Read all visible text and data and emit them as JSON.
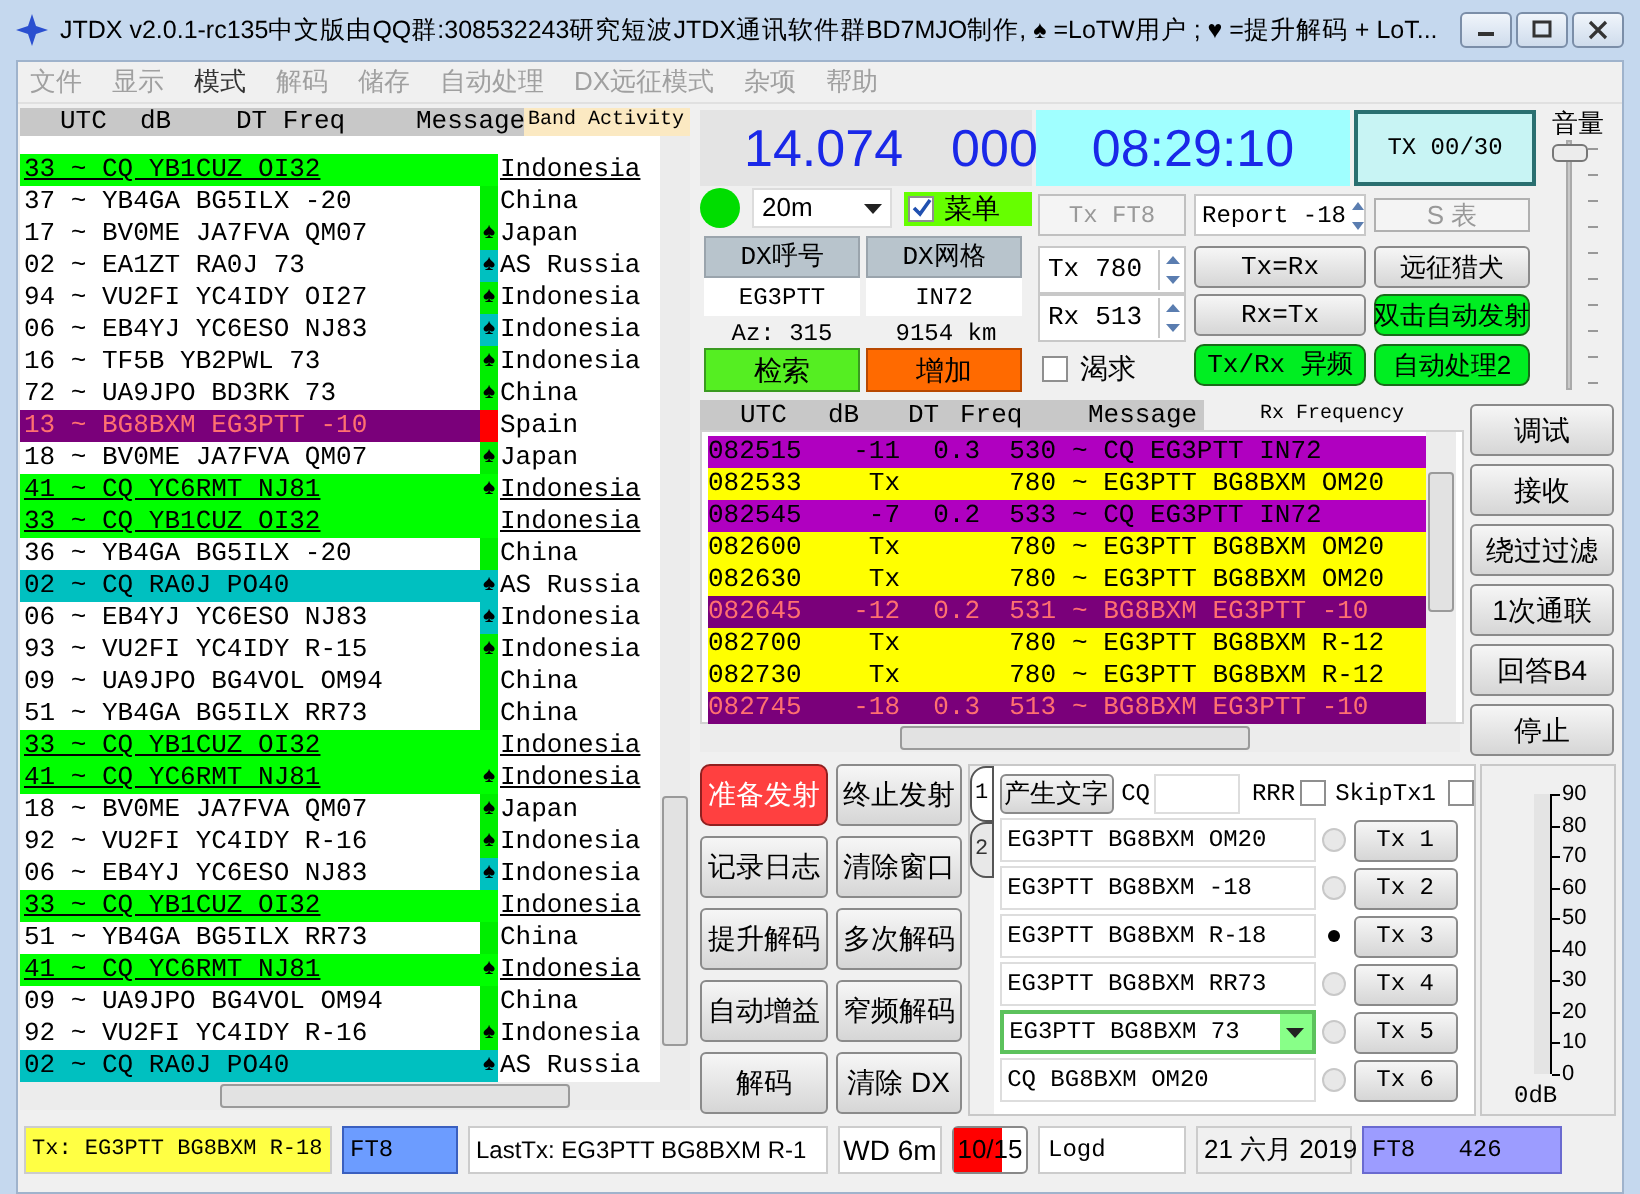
{
  "window": {
    "title": "JTDX  v2.0.1-rc135中文版由QQ群:308532243研究短波JTDX通讯软件群BD7MJO制作, ♠ =LoTW用户 ; ♥ =提升解码 + LoT..."
  },
  "menu": [
    {
      "label": "文件",
      "disabled": true
    },
    {
      "label": "显示",
      "disabled": true
    },
    {
      "label": "模式",
      "disabled": false
    },
    {
      "label": "解码",
      "disabled": true
    },
    {
      "label": "储存",
      "disabled": true
    },
    {
      "label": "自动处理",
      "disabled": true
    },
    {
      "label": "DX远征模式",
      "disabled": true
    },
    {
      "label": "杂项",
      "disabled": true
    },
    {
      "label": "帮助",
      "disabled": true
    }
  ],
  "band_activity": {
    "title": "Band Activity",
    "columns": [
      "UTC",
      "dB",
      "DT Freq",
      "Message"
    ],
    "rows": [
      {
        "text": "33 ~ CQ YB1CUZ OI32",
        "country": "Indonesia",
        "kind": "cq",
        "color": "#00ff00"
      },
      {
        "text": "37 ~ YB4GA BG5ILX -20",
        "country": "China",
        "kind": "plain",
        "color": "#00ee00"
      },
      {
        "text": "17 ~ BV0ME JA7FVA QM07",
        "mark": "♠",
        "country": "Japan",
        "kind": "plain",
        "color": "#00ee00"
      },
      {
        "text": "02 ~ EA1ZT RA0J 73",
        "mark": "♠",
        "country": "AS Russia",
        "kind": "plain",
        "color": "#00c0c0"
      },
      {
        "text": "94 ~ VU2FI YC4IDY OI27",
        "mark": "♠",
        "country": "Indonesia",
        "kind": "plain",
        "color": "#00ee00"
      },
      {
        "text": "06 ~ EB4YJ YC6ESO NJ83",
        "mark": "♠",
        "country": "Indonesia",
        "kind": "plain",
        "color": "#00c0c0"
      },
      {
        "text": "16 ~ TF5B YB2PWL 73",
        "mark": "♠",
        "country": "Indonesia",
        "kind": "plain",
        "color": "#00ee00"
      },
      {
        "text": "72 ~ UA9JPO BD3RK 73",
        "mark": "♠",
        "country": "China",
        "kind": "plain",
        "color": "#00ee00"
      },
      {
        "text": "13 ~ BG8BXM EG3PTT -10",
        "country": "Spain",
        "kind": "me",
        "color": "#ff0000"
      },
      {
        "text": "18 ~ BV0ME JA7FVA QM07",
        "mark": "♠",
        "country": "Japan",
        "kind": "plain",
        "color": "#00ee00"
      },
      {
        "text": "41 ~ CQ YC6RMT NJ81",
        "mark": "♠",
        "country": "Indonesia",
        "kind": "cq",
        "color": "#00ff00"
      },
      {
        "text": "33 ~ CQ YB1CUZ OI32",
        "country": "Indonesia",
        "kind": "cq",
        "color": "#00ff00"
      },
      {
        "text": "36 ~ YB4GA BG5ILX -20",
        "country": "China",
        "kind": "plain",
        "color": "#00ee00"
      },
      {
        "text": "02 ~ CQ RA0J PO40",
        "mark": "♠",
        "country": "AS Russia",
        "kind": "dx",
        "color": "#00c0c0"
      },
      {
        "text": "06 ~ EB4YJ YC6ESO NJ83",
        "mark": "♠",
        "country": "Indonesia",
        "kind": "plain",
        "color": "#00c0c0"
      },
      {
        "text": "93 ~ VU2FI YC4IDY R-15",
        "mark": "♠",
        "country": "Indonesia",
        "kind": "plain",
        "color": "#00ee00"
      },
      {
        "text": "09 ~ UA9JPO BG4VOL OM94",
        "country": "China",
        "kind": "plain",
        "color": "#00ee00"
      },
      {
        "text": "51 ~ YB4GA BG5ILX RR73",
        "country": "China",
        "kind": "plain",
        "color": "#00ee00"
      },
      {
        "text": "33 ~ CQ YB1CUZ OI32",
        "country": "Indonesia",
        "kind": "cq",
        "color": "#00ff00"
      },
      {
        "text": "41 ~ CQ YC6RMT NJ81",
        "mark": "♠",
        "country": "Indonesia",
        "kind": "cq",
        "color": "#00ff00"
      },
      {
        "text": "18 ~ BV0ME JA7FVA QM07",
        "mark": "♠",
        "country": "Japan",
        "kind": "plain",
        "color": "#00ee00"
      },
      {
        "text": "92 ~ VU2FI YC4IDY R-16",
        "mark": "♠",
        "country": "Indonesia",
        "kind": "plain",
        "color": "#00ee00"
      },
      {
        "text": "06 ~ EB4YJ YC6ESO NJ83",
        "mark": "♠",
        "country": "Indonesia",
        "kind": "plain",
        "color": "#00c0c0"
      },
      {
        "text": "33 ~ CQ YB1CUZ OI32",
        "country": "Indonesia",
        "kind": "cq",
        "color": "#00ff00"
      },
      {
        "text": "51 ~ YB4GA BG5ILX RR73",
        "country": "China",
        "kind": "plain",
        "color": "#00ee00"
      },
      {
        "text": "41 ~ CQ YC6RMT NJ81",
        "mark": "♠",
        "country": "Indonesia",
        "kind": "cq",
        "color": "#00ff00"
      },
      {
        "text": "09 ~ UA9JPO BG4VOL OM94",
        "country": "China",
        "kind": "plain",
        "color": "#00ee00"
      },
      {
        "text": "92 ~ VU2FI YC4IDY R-16",
        "mark": "♠",
        "country": "Indonesia",
        "kind": "plain",
        "color": "#00ee00"
      },
      {
        "text": "02 ~ CQ RA0J PO40",
        "mark": "♠",
        "country": "AS Russia",
        "kind": "dx",
        "color": "#00c0c0"
      }
    ]
  },
  "frequency": {
    "mhz": "14.074",
    "hz": "000"
  },
  "clock": "08:29:10",
  "tx_counter": "TX 00/30",
  "volume": {
    "label": "音量",
    "level": 0.98
  },
  "band": {
    "value": "20m",
    "online": true
  },
  "menu_toggle": {
    "label": "菜单",
    "checked": true
  },
  "dx": {
    "call_label": "DX呼号",
    "grid_label": "DX网格",
    "call": "EG3PTT",
    "grid": "IN72",
    "azimuth": "Az: 315",
    "distance": "9154 km",
    "lookup": "检索",
    "add": "增加"
  },
  "controls": {
    "tx_mode": {
      "label": "Tx FT8",
      "disabled": true
    },
    "report": "Report -18",
    "s_meter": {
      "label": "S 表",
      "disabled": true
    },
    "tx_freq": {
      "label": "Tx",
      "value": "780"
    },
    "rx_freq": {
      "label": "Rx",
      "value": "513"
    },
    "want": {
      "label": "渴求",
      "checked": false
    },
    "buttons": [
      {
        "label": "Tx=Rx",
        "on": false
      },
      {
        "label": "远征猎犬",
        "on": false
      },
      {
        "label": "Rx=Tx",
        "on": false
      },
      {
        "label": "双击自动发射",
        "on": true
      },
      {
        "label": "Tx/Rx 异频",
        "on": true
      },
      {
        "label": "自动处理2",
        "on": true
      }
    ]
  },
  "rx_frequency": {
    "title": "Rx Frequency",
    "columns": [
      "UTC",
      "dB",
      "DT",
      "Freq",
      "Message"
    ],
    "rows": [
      {
        "utc": "082515",
        "db": "-11",
        "dt": "0.3",
        "freq": "530",
        "message": "~ CQ EG3PTT IN72",
        "kind": "rx"
      },
      {
        "utc": "082533",
        "db": "Tx",
        "freq": "780",
        "message": "~ EG3PTT BG8BXM OM20",
        "kind": "tx"
      },
      {
        "utc": "082545",
        "db": "-7",
        "dt": "0.2",
        "freq": "533",
        "message": "~ CQ EG3PTT IN72",
        "kind": "rx"
      },
      {
        "utc": "082600",
        "db": "Tx",
        "freq": "780",
        "message": "~ EG3PTT BG8BXM OM20",
        "kind": "tx"
      },
      {
        "utc": "082630",
        "db": "Tx",
        "freq": "780",
        "message": "~ EG3PTT BG8BXM OM20",
        "kind": "tx"
      },
      {
        "utc": "082645",
        "db": "-12",
        "dt": "0.2",
        "freq": "531",
        "message": "~ BG8BXM EG3PTT -10",
        "kind": "me"
      },
      {
        "utc": "082700",
        "db": "Tx",
        "freq": "780",
        "message": "~ EG3PTT BG8BXM R-12",
        "kind": "tx"
      },
      {
        "utc": "082730",
        "db": "Tx",
        "freq": "780",
        "message": "~ EG3PTT BG8BXM R-12",
        "kind": "tx"
      },
      {
        "utc": "082745",
        "db": "-18",
        "dt": "0.3",
        "freq": "513",
        "message": "~ BG8BXM EG3PTT -10",
        "kind": "me"
      }
    ]
  },
  "side_buttons": [
    "调试",
    "接收",
    "绕过过滤",
    "1次通联",
    "回答B4",
    "停止"
  ],
  "action_buttons": [
    {
      "label": "准备发射",
      "on": true
    },
    {
      "label": "终止发射",
      "on": false
    },
    {
      "label": "记录日志",
      "on": false
    },
    {
      "label": "清除窗口",
      "on": false
    },
    {
      "label": "提升解码",
      "on": false
    },
    {
      "label": "多次解码",
      "on": false
    },
    {
      "label": "自动增益",
      "on": false
    },
    {
      "label": "窄频解码",
      "on": false
    },
    {
      "label": "解码",
      "on": false
    },
    {
      "label": "清除 DX",
      "on": false
    }
  ],
  "tabs": [
    {
      "label": "1",
      "selected": true
    },
    {
      "label": "2",
      "selected": false
    }
  ],
  "generate": "产生文字",
  "cq_label": "CQ",
  "rrr": {
    "label": "RRR",
    "checked": false
  },
  "skip_tx1": {
    "label": "SkipTx1",
    "checked": false
  },
  "messages": [
    {
      "text": "EG3PTT BG8BXM OM20",
      "button": "Tx 1",
      "selected": false,
      "kind": "field"
    },
    {
      "text": "EG3PTT BG8BXM -18",
      "button": "Tx 2",
      "selected": false,
      "kind": "field"
    },
    {
      "text": "EG3PTT BG8BXM R-18",
      "button": "Tx 3",
      "selected": true,
      "kind": "field"
    },
    {
      "text": "EG3PTT BG8BXM RR73",
      "button": "Tx 4",
      "selected": false,
      "kind": "field"
    },
    {
      "text": "EG3PTT BG8BXM 73",
      "button": "Tx 5",
      "selected": false,
      "kind": "combo"
    },
    {
      "text": "CQ BG8BXM OM20",
      "button": "Tx 6",
      "selected": false,
      "kind": "field"
    }
  ],
  "meter": {
    "scale": [
      "90",
      "80",
      "70",
      "60",
      "50",
      "40",
      "30",
      "20",
      "10",
      "0"
    ],
    "unit": "0dB",
    "level": 0
  },
  "status": {
    "tx": "Tx: EG3PTT BG8BXM R-18",
    "mode": "FT8",
    "last_tx": "LastTx: EG3PTT BG8BXM R-1",
    "wd": "WD 6m",
    "count": {
      "text": "10/15",
      "level": 0.67
    },
    "log": "Logd",
    "date": "21 六月 2019",
    "mode_freq": "FT8   426"
  }
}
